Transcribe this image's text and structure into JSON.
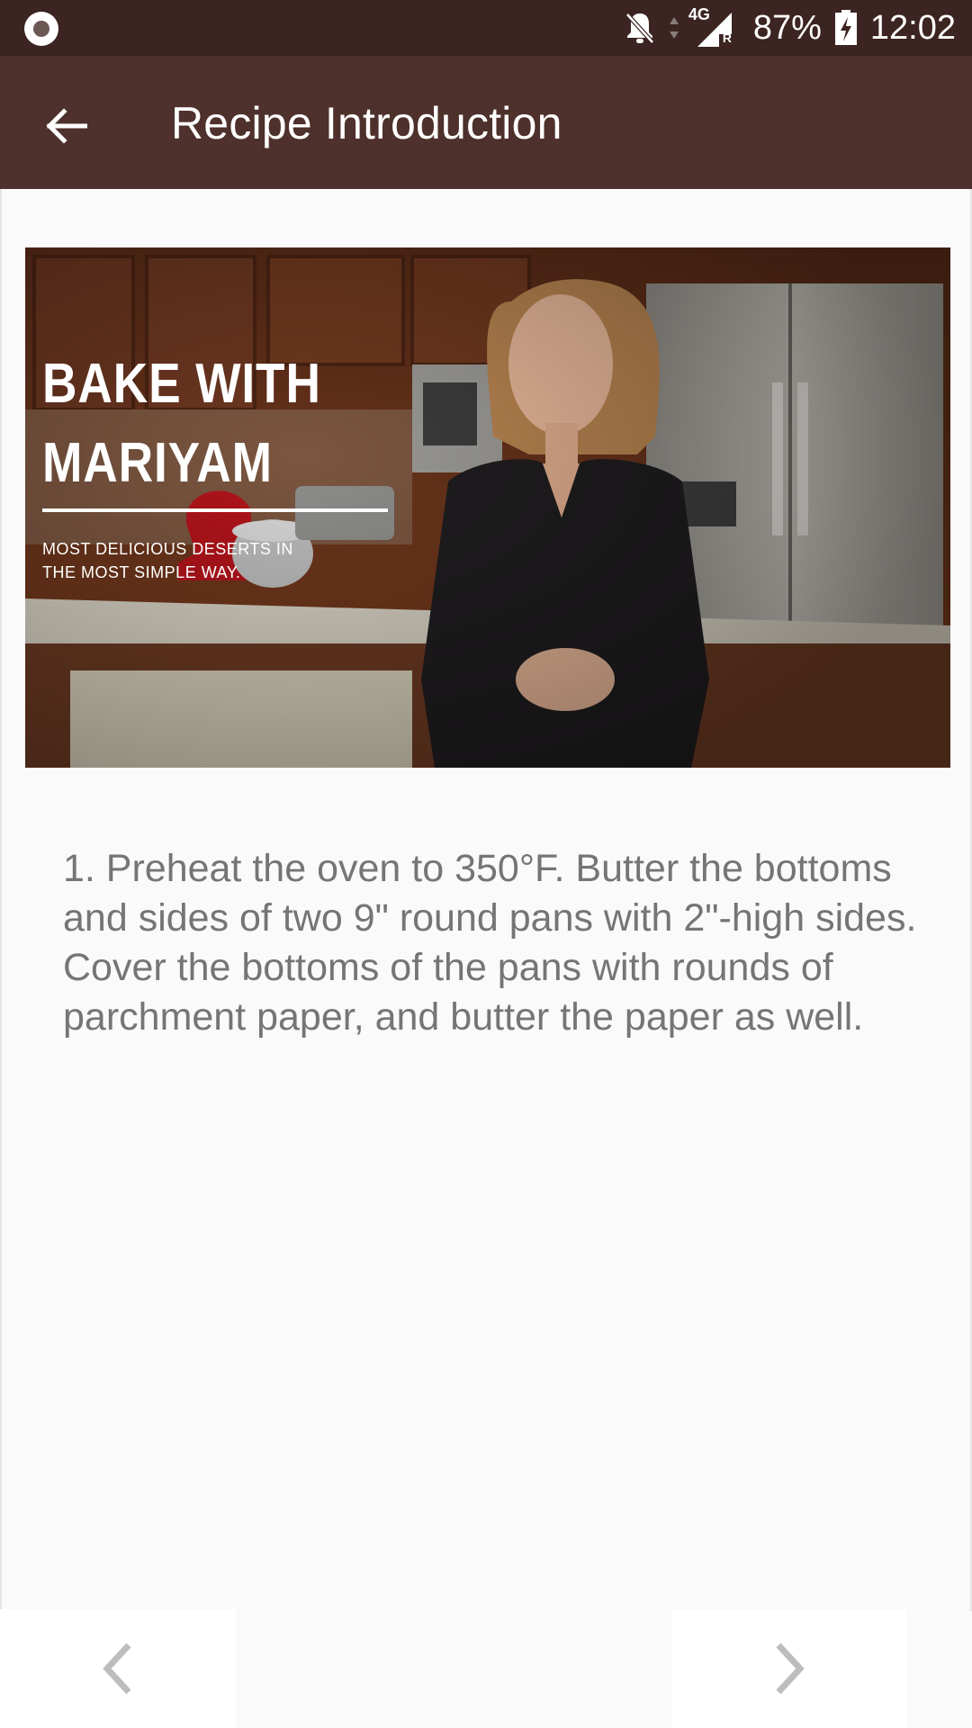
{
  "status_bar": {
    "network": "4G",
    "roaming": "R",
    "battery_percent": "87%",
    "time": "12:02",
    "icons": [
      "record-icon",
      "bell-off-icon",
      "data-arrows-icon",
      "signal-icon",
      "battery-charging-icon"
    ]
  },
  "app_bar": {
    "title": "Recipe Introduction",
    "back_icon": "arrow-left-icon"
  },
  "hero": {
    "title_line1": "BAKE WITH",
    "title_line2": "MARIYAM",
    "subtitle": "MOST DELICIOUS DESERTS IN\nTHE MOST SIMPLE WAY."
  },
  "step": {
    "text": "1. Preheat the oven to 350°F. Butter the bottoms and sides of two 9\" round pans with 2\"-high sides. Cover the bottoms of the pans with rounds of parchment paper, and butter the paper as well."
  },
  "navigation": {
    "prev_icon": "chevron-left-icon",
    "next_icon": "chevron-right-icon"
  },
  "colors": {
    "status_bar": "#3b2421",
    "app_bar": "#4e312c",
    "body_text": "#757575",
    "background": "#fafafa"
  }
}
